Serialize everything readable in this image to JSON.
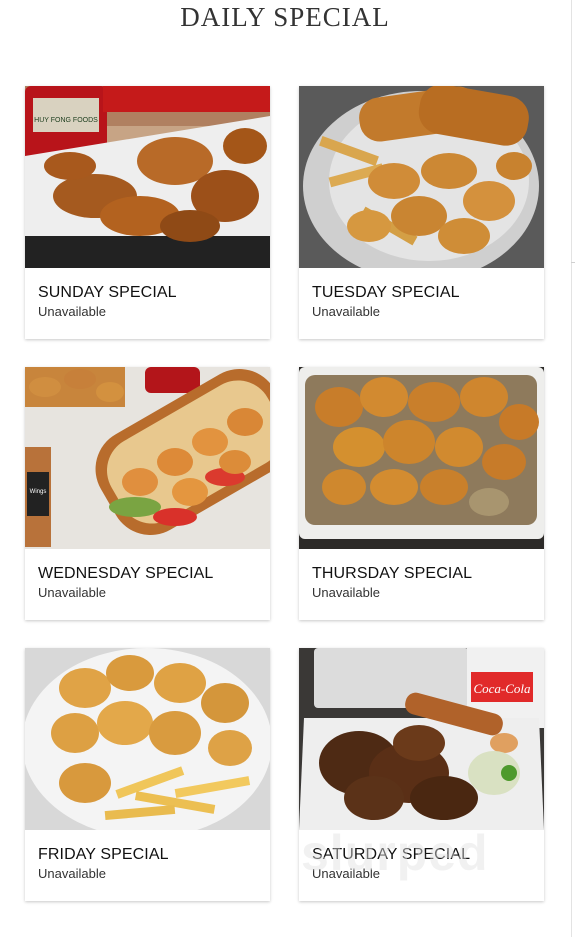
{
  "page": {
    "title": "DAILY SPECIAL"
  },
  "specials": [
    {
      "day": "SUNDAY SPECIAL",
      "status": "Unavailable",
      "photo_icon": "fried-chicken-wings-icon"
    },
    {
      "day": "TUESDAY SPECIAL",
      "status": "Unavailable",
      "photo_icon": "fried-shrimp-and-fish-icon"
    },
    {
      "day": "WEDNESDAY SPECIAL",
      "status": "Unavailable",
      "photo_icon": "shrimp-po-boy-icon"
    },
    {
      "day": "THURSDAY SPECIAL",
      "status": "Unavailable",
      "photo_icon": "bang-bang-shrimp-rice-icon"
    },
    {
      "day": "FRIDAY SPECIAL",
      "status": "Unavailable",
      "photo_icon": "fried-shrimp-and-fries-icon"
    },
    {
      "day": "SATURDAY SPECIAL",
      "status": "Unavailable",
      "photo_icon": "teriyaki-chicken-egg-roll-icon"
    }
  ],
  "photo_text": {
    "sriracha_label": "HUY FONG FOODS",
    "cup_brand": "Coca-Cola",
    "menu_card_text": "Wings",
    "watermark": "slurped"
  },
  "colors": {
    "title": "#333333",
    "card_title": "#111111",
    "card_status": "#333333",
    "card_shadow": "rgba(0,0,0,0.22)"
  }
}
